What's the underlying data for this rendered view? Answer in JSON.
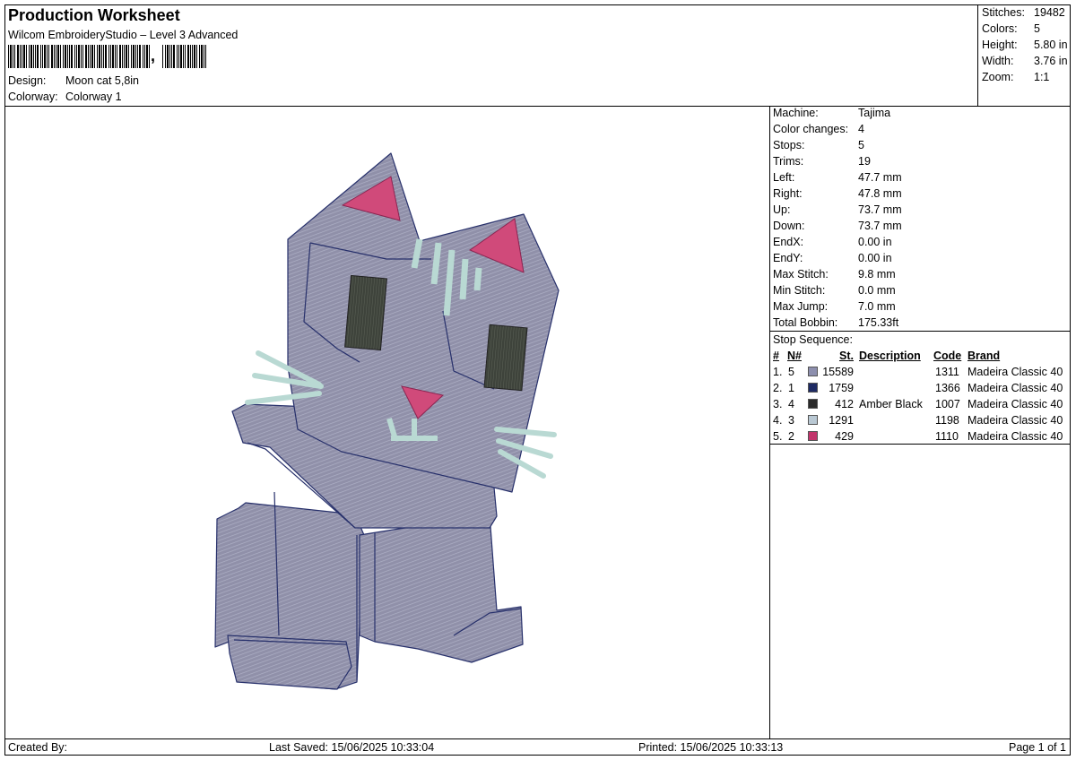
{
  "header": {
    "title": "Production Worksheet",
    "software": "Wilcom EmbroideryStudio – Level 3 Advanced",
    "barcode_suffix": ",",
    "design_label": "Design:",
    "design_value": "Moon cat 5,8in",
    "colorway_label": "Colorway:",
    "colorway_value": "Colorway 1"
  },
  "summary": [
    {
      "label": "Stitches:",
      "value": "19482"
    },
    {
      "label": "Colors:",
      "value": "5"
    },
    {
      "label": "Height:",
      "value": "5.80 in"
    },
    {
      "label": "Width:",
      "value": "3.76 in"
    },
    {
      "label": "Zoom:",
      "value": "1:1"
    }
  ],
  "machine_info": [
    {
      "label": "Machine:",
      "value": "Tajima"
    },
    {
      "label": "Color changes:",
      "value": "4"
    },
    {
      "label": "Stops:",
      "value": "5"
    },
    {
      "label": "Trims:",
      "value": "19"
    },
    {
      "label": "Left:",
      "value": "47.7 mm"
    },
    {
      "label": "Right:",
      "value": "47.8 mm"
    },
    {
      "label": "Up:",
      "value": "73.7 mm"
    },
    {
      "label": "Down:",
      "value": "73.7 mm"
    },
    {
      "label": "EndX:",
      "value": "0.00 in"
    },
    {
      "label": "EndY:",
      "value": "0.00 in"
    },
    {
      "label": "Max Stitch:",
      "value": "9.8 mm"
    },
    {
      "label": "Min Stitch:",
      "value": "0.0 mm"
    },
    {
      "label": "Max Jump:",
      "value": "7.0 mm"
    },
    {
      "label": "Total Bobbin:",
      "value": "175.33ft"
    }
  ],
  "stop_sequence": {
    "title": "Stop Sequence:",
    "headers": {
      "num": "#",
      "n": "N#",
      "st": "St.",
      "description": "Description",
      "code": "Code",
      "brand": "Brand"
    },
    "rows": [
      {
        "num": "1.",
        "n": "5",
        "color": "#8d8fae",
        "st": "15589",
        "description": "",
        "code": "1311",
        "brand": "Madeira Classic 40"
      },
      {
        "num": "2.",
        "n": "1",
        "color": "#1d2a63",
        "st": "1759",
        "description": "",
        "code": "1366",
        "brand": "Madeira Classic 40"
      },
      {
        "num": "3.",
        "n": "4",
        "color": "#2a2a2a",
        "st": "412",
        "description": "Amber Black",
        "code": "1007",
        "brand": "Madeira Classic 40"
      },
      {
        "num": "4.",
        "n": "3",
        "color": "#b9c8d3",
        "st": "1291",
        "description": "",
        "code": "1198",
        "brand": "Madeira Classic 40"
      },
      {
        "num": "5.",
        "n": "2",
        "color": "#c2356c",
        "st": "429",
        "description": "",
        "code": "1110",
        "brand": "Madeira Classic 40"
      }
    ]
  },
  "footer": {
    "created_by": "Created By:",
    "last_saved": "Last Saved: 15/06/2025 10:33:04",
    "printed": "Printed: 15/06/2025 10:33:13",
    "page": "Page 1 of 1"
  },
  "design_colors": {
    "body": "#8a8aa3",
    "outline": "#27306b",
    "eyes": "#3b4038",
    "whiskers": "#b9d9d3",
    "pink": "#d04a7a"
  }
}
